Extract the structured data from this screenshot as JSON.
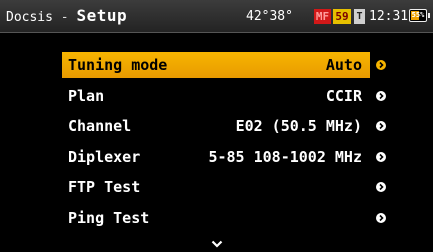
{
  "header": {
    "app": "Docsis",
    "separator": " - ",
    "title": "Setup",
    "coords": "42°38°",
    "badge_mf": "MF",
    "badge_num": "59",
    "badge_t": "T",
    "time": "12:31",
    "battery_percent": "55%",
    "battery_level": 0.55
  },
  "menu": {
    "items": [
      {
        "label": "Tuning mode",
        "value": "Auto",
        "selected": true
      },
      {
        "label": "Plan",
        "value": "CCIR",
        "selected": false
      },
      {
        "label": "Channel",
        "value": "E02 (50.5 MHz)",
        "selected": false
      },
      {
        "label": "Diplexer",
        "value": "5-85 108-1002 MHz",
        "selected": false
      },
      {
        "label": "FTP Test",
        "value": "",
        "selected": false
      },
      {
        "label": "Ping Test",
        "value": "",
        "selected": false
      }
    ]
  },
  "colors": {
    "highlight": "#f7b500",
    "background": "#000000",
    "text": "#ffffff"
  },
  "icons": {
    "row_arrow": "chevron-right-circle-icon",
    "scroll_more": "chevron-down-icon"
  }
}
